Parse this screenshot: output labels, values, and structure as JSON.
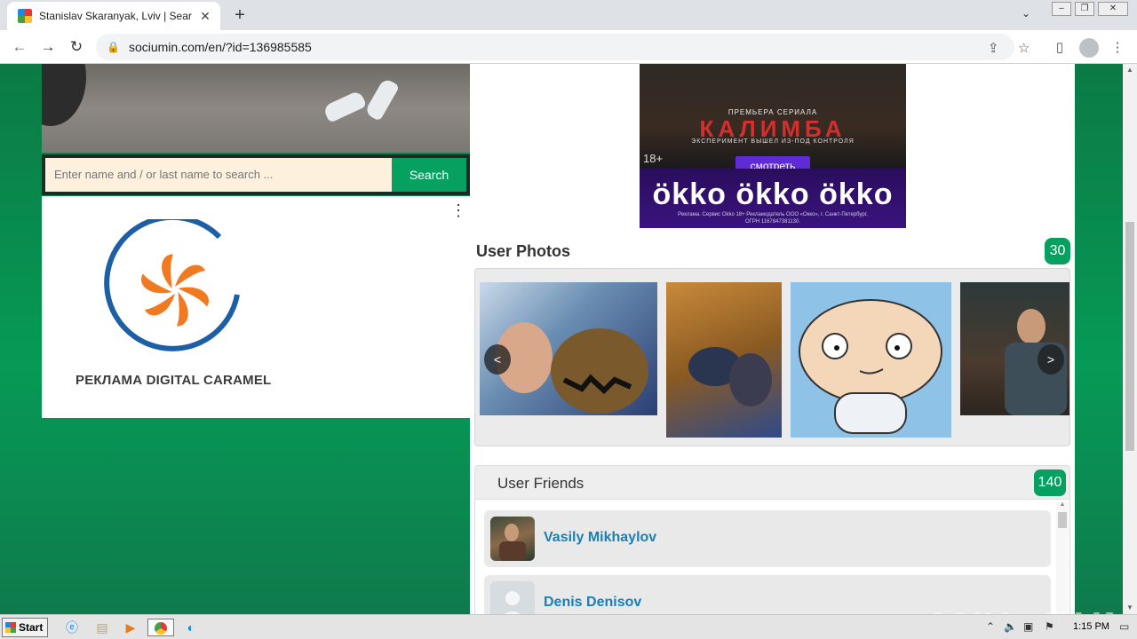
{
  "browser": {
    "tab_title": "Stanislav Skaranyak, Lviv | Search In",
    "tab_close": "✕",
    "new_tab": "+",
    "url": "sociumin.com/en/?id=136985585"
  },
  "search": {
    "placeholder": "Enter name and / or last name to search ...",
    "button_label": "Search"
  },
  "left_ad": {
    "caption": "РЕКЛАМА DIGITAL CARAMEL",
    "menu": "⋮"
  },
  "banner_ad": {
    "subtitle": "ПРЕМЬЕРА СЕРИАЛА",
    "title": "КАЛИМБА",
    "tagline": "ЭКСПЕРИМЕНТ ВЫШЕЛ ИЗ-ПОД КОНТРОЛЯ",
    "age_rating": "18+",
    "cta": "смотреть",
    "brand": "ökko ökko ökko",
    "legal": "Реклама. Сервис Okko 18+ Рекламодатель ООО «Окко», г. Санкт-Петербург, ОГРН 1167847381130."
  },
  "photos": {
    "heading": "User Photos",
    "count": "30",
    "prev": "<",
    "next": ">"
  },
  "friends": {
    "heading": "User Friends",
    "count": "140",
    "items": [
      {
        "name": "Vasily Mikhaylov"
      },
      {
        "name": "Denis Denisov"
      }
    ]
  },
  "watermark": "ANY▷RUN",
  "taskbar": {
    "start_label": "Start",
    "clock": "1:15 PM"
  },
  "colors": {
    "accent_green": "#06a060",
    "page_background": "#0b7a45",
    "link_blue": "#1a7fb2"
  }
}
